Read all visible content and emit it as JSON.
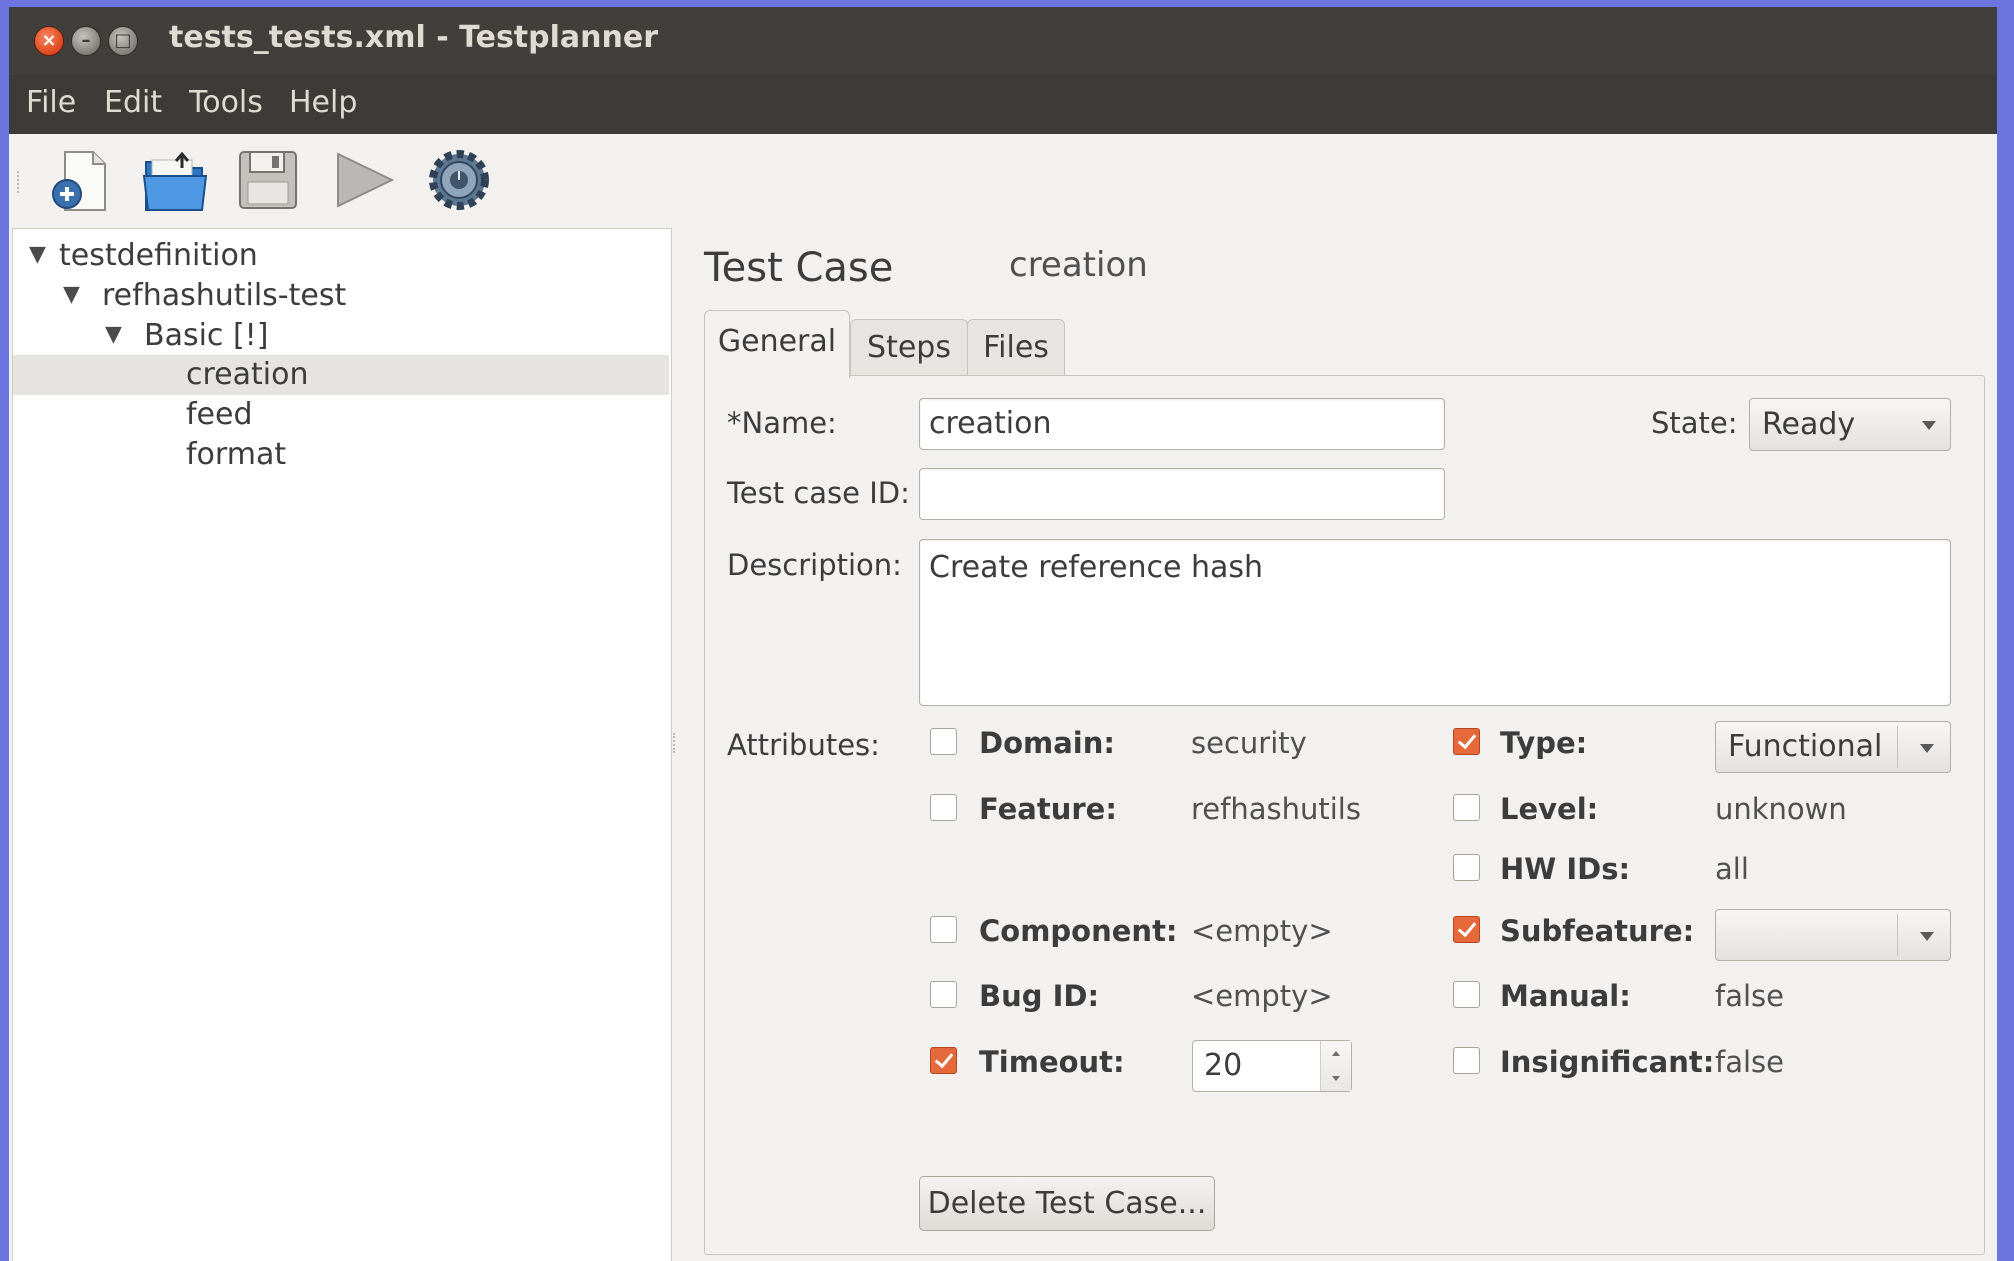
{
  "window": {
    "title": "tests_tests.xml - Testplanner",
    "close_glyph": "×",
    "minimize_glyph": "–",
    "maximize_glyph": "□"
  },
  "menu": [
    "File",
    "Edit",
    "Tools",
    "Help"
  ],
  "toolbar": {
    "items": [
      {
        "icon": "new-file-icon"
      },
      {
        "icon": "open-folder-icon"
      },
      {
        "icon": "save-icon"
      },
      {
        "icon": "run-icon"
      },
      {
        "icon": "settings-icon"
      }
    ]
  },
  "tree": {
    "root": "testdefinition",
    "suite": "refhashutils-test",
    "set": "Basic [!]",
    "cases": [
      "creation",
      "feed",
      "format"
    ],
    "selected": "creation"
  },
  "detail": {
    "heading": "Test Case",
    "heading_value": "creation",
    "tabs": [
      "General",
      "Steps",
      "Files"
    ],
    "active_tab": "General"
  },
  "form": {
    "name_label": "*Name:",
    "name_value": "creation",
    "state_label": "State:",
    "state_value": "Ready",
    "testcase_id_label": "Test case ID:",
    "testcase_id_value": "",
    "description_label": "Description:",
    "description_value": "Create reference hash",
    "attributes_label": "Attributes:",
    "delete_button": "Delete Test Case..."
  },
  "attributes": {
    "domain": {
      "label": "Domain:",
      "value": "security",
      "checked": false
    },
    "feature": {
      "label": "Feature:",
      "value": "refhashutils",
      "checked": false
    },
    "component": {
      "label": "Component:",
      "value": "<empty>",
      "checked": false
    },
    "bug_id": {
      "label": "Bug ID:",
      "value": "<empty>",
      "checked": false
    },
    "timeout": {
      "label": "Timeout:",
      "value": "20",
      "checked": true
    },
    "type": {
      "label": "Type:",
      "value": "Functional",
      "checked": true
    },
    "level": {
      "label": "Level:",
      "value": "unknown",
      "checked": false
    },
    "hw_ids": {
      "label": "HW IDs:",
      "value": "all",
      "checked": false
    },
    "subfeature": {
      "label": "Subfeature:",
      "value": "",
      "checked": true
    },
    "manual": {
      "label": "Manual:",
      "value": "false",
      "checked": false
    },
    "insignificant": {
      "label": "Insignificant:",
      "value": "false",
      "checked": false
    }
  },
  "colors": {
    "accent": "#e5693b",
    "titlebar": "#403f3b",
    "menubar": "#3c3b37",
    "window_bg": "#f2f1f0",
    "desktop": "#6d76e0"
  }
}
